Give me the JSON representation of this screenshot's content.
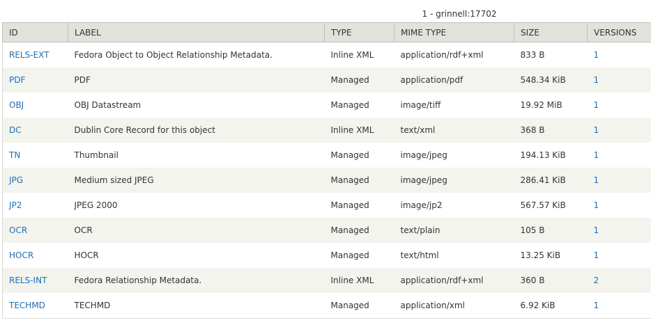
{
  "caption": "1 - grinnell:17702",
  "columns": [
    "ID",
    "LABEL",
    "TYPE",
    "MIME TYPE",
    "SIZE",
    "VERSIONS"
  ],
  "rows": [
    {
      "id": "RELS-EXT",
      "label": "Fedora Object to Object Relationship Metadata.",
      "type": "Inline XML",
      "mime": "application/rdf+xml",
      "size": "833 B",
      "versions": "1"
    },
    {
      "id": "PDF",
      "label": "PDF",
      "type": "Managed",
      "mime": "application/pdf",
      "size": "548.34 KiB",
      "versions": "1"
    },
    {
      "id": "OBJ",
      "label": "OBJ Datastream",
      "type": "Managed",
      "mime": "image/tiff",
      "size": "19.92 MiB",
      "versions": "1"
    },
    {
      "id": "DC",
      "label": "Dublin Core Record for this object",
      "type": "Inline XML",
      "mime": "text/xml",
      "size": "368 B",
      "versions": "1"
    },
    {
      "id": "TN",
      "label": "Thumbnail",
      "type": "Managed",
      "mime": "image/jpeg",
      "size": "194.13 KiB",
      "versions": "1"
    },
    {
      "id": "JPG",
      "label": "Medium sized JPEG",
      "type": "Managed",
      "mime": "image/jpeg",
      "size": "286.41 KiB",
      "versions": "1"
    },
    {
      "id": "JP2",
      "label": "JPEG 2000",
      "type": "Managed",
      "mime": "image/jp2",
      "size": "567.57 KiB",
      "versions": "1"
    },
    {
      "id": "OCR",
      "label": "OCR",
      "type": "Managed",
      "mime": "text/plain",
      "size": "105 B",
      "versions": "1"
    },
    {
      "id": "HOCR",
      "label": "HOCR",
      "type": "Managed",
      "mime": "text/html",
      "size": "13.25 KiB",
      "versions": "1"
    },
    {
      "id": "RELS-INT",
      "label": "Fedora Relationship Metadata.",
      "type": "Inline XML",
      "mime": "application/rdf+xml",
      "size": "360 B",
      "versions": "2"
    },
    {
      "id": "TECHMD",
      "label": "TECHMD",
      "type": "Managed",
      "mime": "application/xml",
      "size": "6.92 KiB",
      "versions": "1"
    }
  ]
}
